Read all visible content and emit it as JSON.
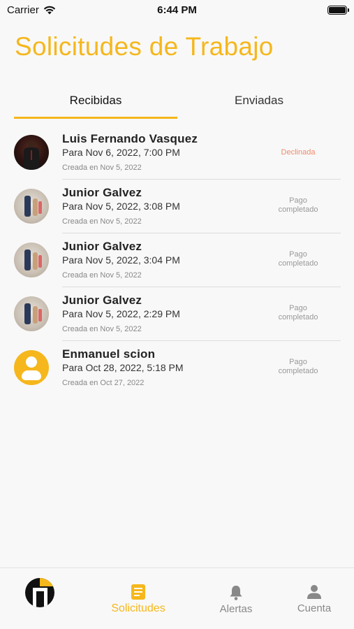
{
  "status_bar": {
    "carrier": "Carrier",
    "time": "6:44 PM"
  },
  "header": {
    "title": "Solicitudes de Trabajo"
  },
  "tabs": [
    {
      "label": "Recibidas",
      "active": true
    },
    {
      "label": "Enviadas",
      "active": false
    }
  ],
  "requests": [
    {
      "name": "Luis Fernando Vasquez",
      "date": "Para Nov 6, 2022, 7:00 PM",
      "created": "Creada en Nov 5, 2022",
      "status": "Declinada",
      "status_color": "#f08a6b"
    },
    {
      "name": "Junior Galvez",
      "date": "Para Nov 5, 2022, 3:08 PM",
      "created": "Creada en Nov 5, 2022",
      "status": "Pago completado",
      "status_color": "#999999"
    },
    {
      "name": "Junior Galvez",
      "date": "Para Nov 5, 2022, 3:04 PM",
      "created": "Creada en Nov 5, 2022",
      "status": "Pago completado",
      "status_color": "#999999"
    },
    {
      "name": "Junior Galvez",
      "date": "Para Nov 5, 2022, 2:29 PM",
      "created": "Creada en Nov 5, 2022",
      "status": "Pago completado",
      "status_color": "#999999"
    },
    {
      "name": "Enmanuel scion",
      "date": "Para Oct 28, 2022, 5:18 PM",
      "created": "Creada en Oct 27, 2022",
      "status": "Pago completado",
      "status_color": "#999999"
    }
  ],
  "bottom_nav": {
    "items": [
      {
        "label": "",
        "icon": "app-logo-icon"
      },
      {
        "label": "Solicitudes",
        "icon": "document-icon",
        "active": true
      },
      {
        "label": "Alertas",
        "icon": "bell-icon"
      },
      {
        "label": "Cuenta",
        "icon": "person-icon"
      }
    ]
  },
  "colors": {
    "accent": "#f5b71c",
    "declined": "#f08a6b",
    "muted": "#999999"
  }
}
